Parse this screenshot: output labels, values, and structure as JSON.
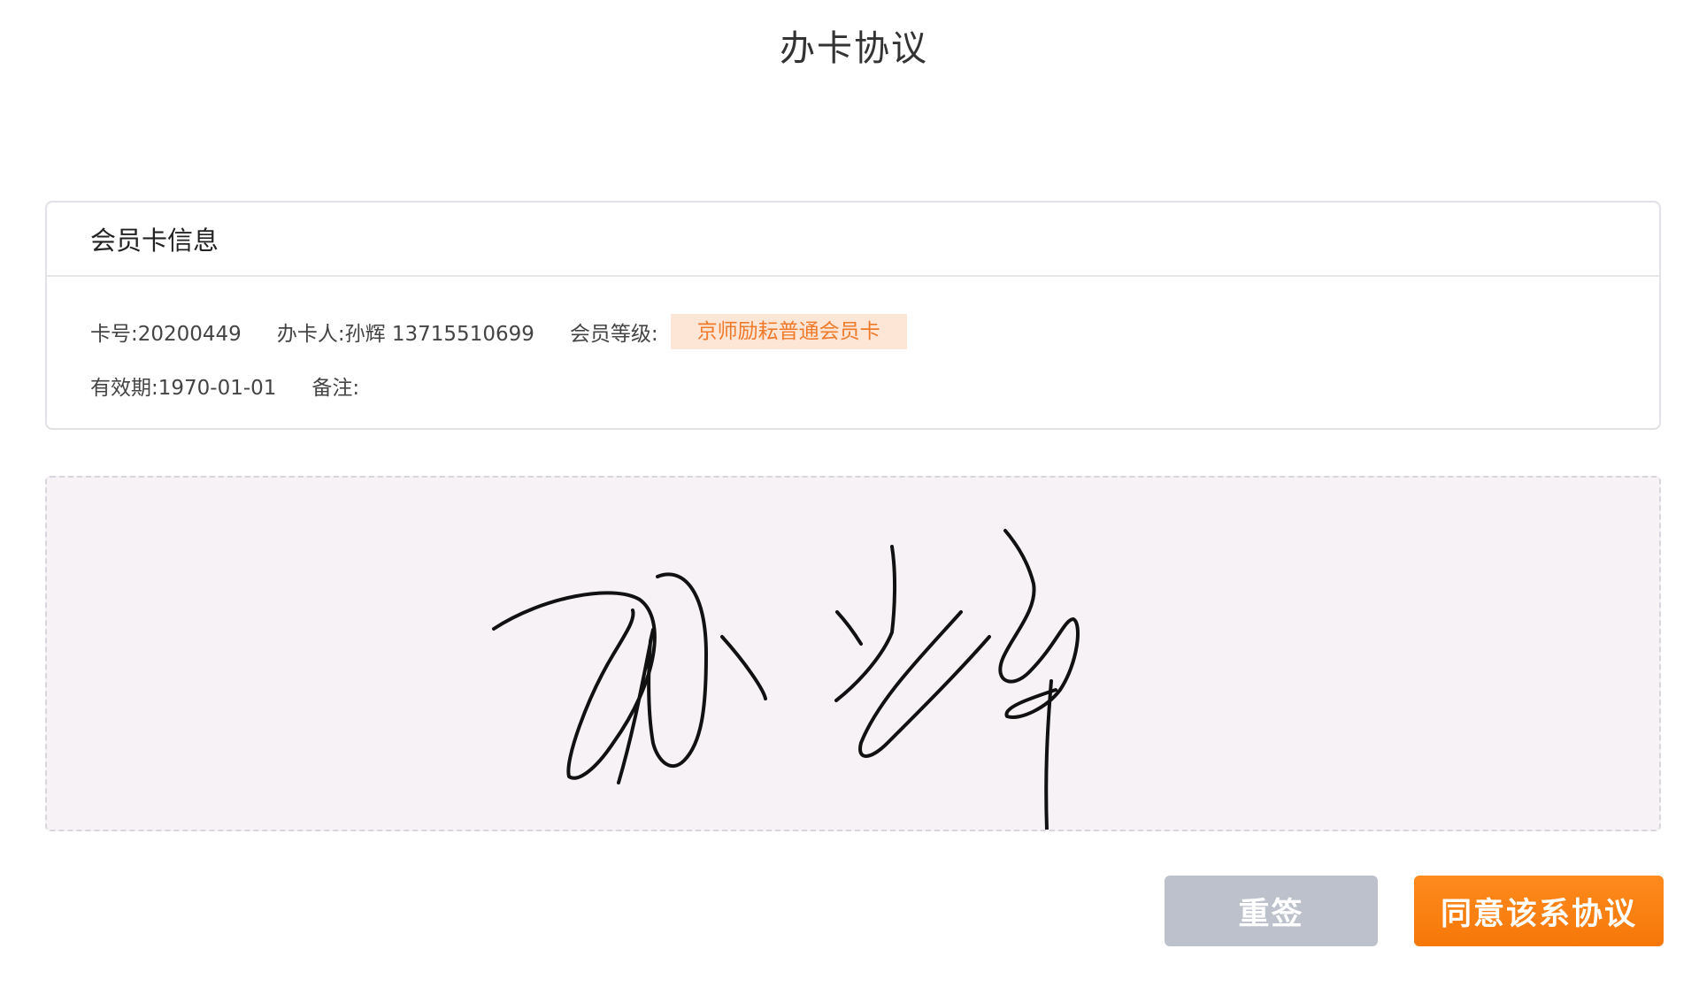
{
  "page": {
    "title": "办卡协议"
  },
  "card_info": {
    "header": "会员卡信息",
    "card_no": "卡号:20200449",
    "holder": "办卡人:孙辉 13715510699",
    "level_label": "会员等级:",
    "level_value": "京师励耘普通会员卡",
    "expiry": "有效期:1970-01-01",
    "remark": "备注:"
  },
  "signature": {
    "status": "signed",
    "name": "孙辉"
  },
  "actions": {
    "resign_label": "重签",
    "agree_label": "同意该系协议"
  },
  "colors": {
    "accent_orange": "#f57808",
    "badge_bg": "#fde6d6",
    "badge_text": "#f07a2a",
    "resign_bg": "#bcc1cc",
    "pad_bg": "#f6f2f5"
  }
}
